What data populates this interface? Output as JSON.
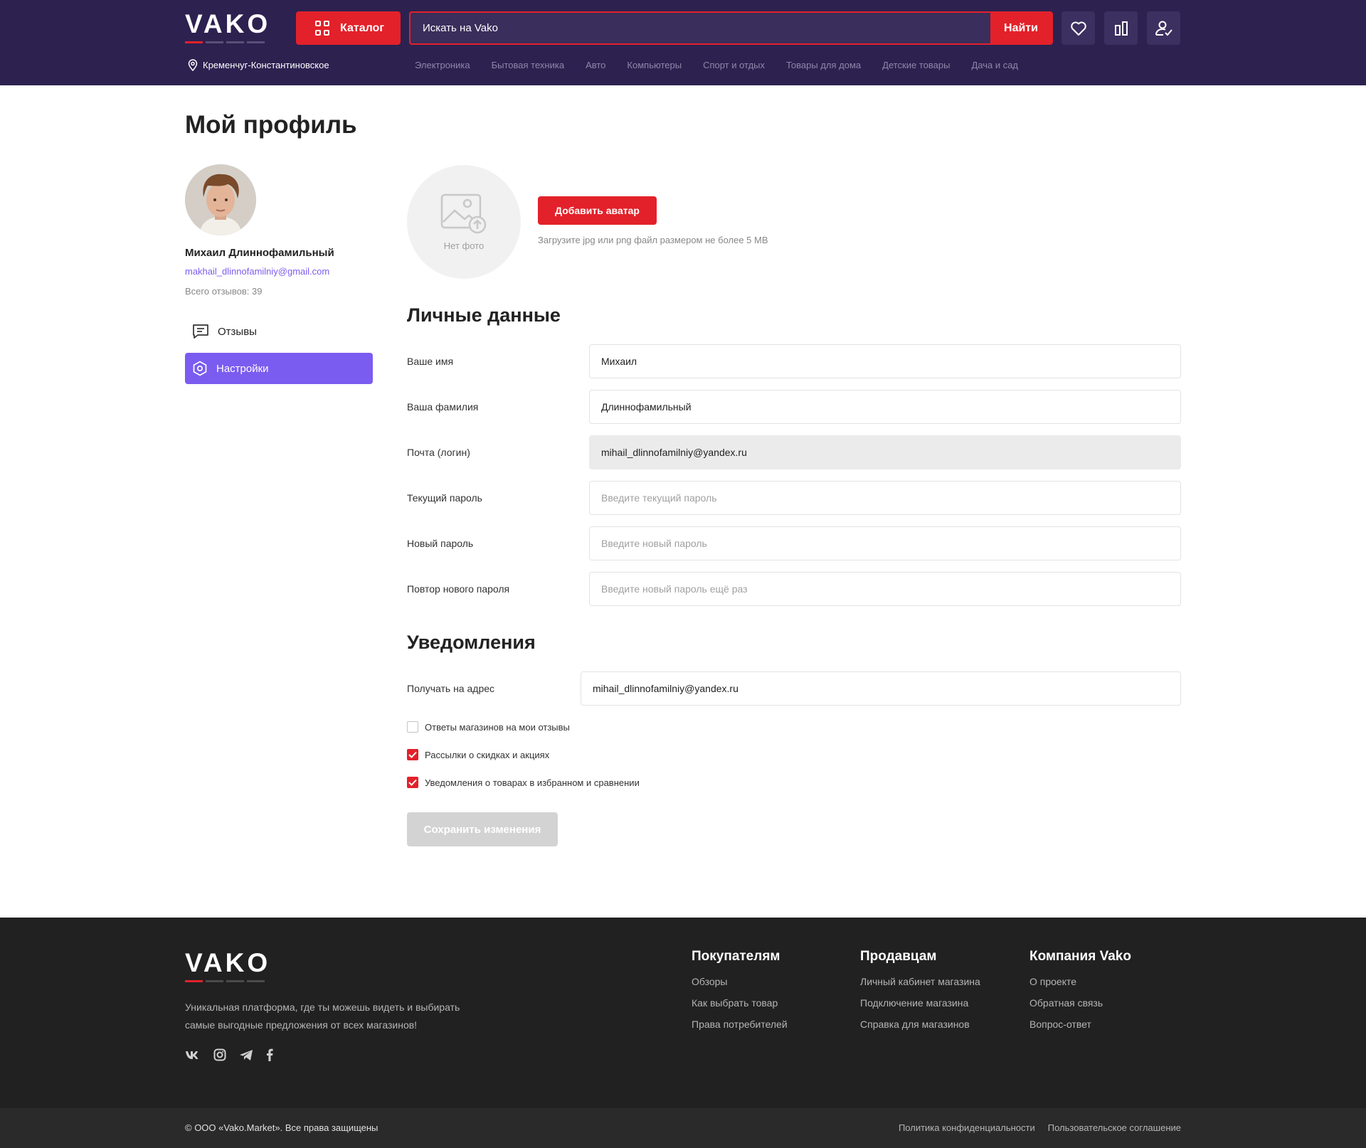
{
  "header": {
    "logo": "VAKO",
    "catalog_label": "Каталог",
    "search_placeholder": "Искать на Vako",
    "search_button": "Найти",
    "location": "Кременчуг-Константиновское",
    "categories": [
      "Электроника",
      "Бытовая техника",
      "Авто",
      "Компьютеры",
      "Спорт и отдых",
      "Товары для дома",
      "Детские товары",
      "Дача и сад"
    ]
  },
  "page": {
    "title": "Мой профиль"
  },
  "profile": {
    "name": "Михаил Длиннофамильный",
    "email": "makhail_dlinnofamilniy@gmail.com",
    "reviews_count": "Всего отзывов: 39"
  },
  "sidebar": {
    "items": [
      {
        "label": "Отзывы",
        "icon": "chat-icon",
        "active": false
      },
      {
        "label": "Настройки",
        "icon": "settings-icon",
        "active": true
      }
    ]
  },
  "avatar_upload": {
    "no_photo": "Нет фото",
    "button": "Добавить аватар",
    "hint": "Загрузите jpg или png файл размером не более 5 MB"
  },
  "personal": {
    "title": "Личные данные",
    "fields": [
      {
        "label": "Ваше имя",
        "value": "Михаил",
        "placeholder": ""
      },
      {
        "label": "Ваша фамилия",
        "value": "Длиннофамильный",
        "placeholder": ""
      },
      {
        "label": "Почта (логин)",
        "value": "mihail_dlinnofamilniy@yandex.ru",
        "placeholder": ""
      },
      {
        "label": "Текущий пароль",
        "value": "",
        "placeholder": "Введите текущий пароль"
      },
      {
        "label": "Новый пароль",
        "value": "",
        "placeholder": "Введите новый пароль"
      },
      {
        "label": "Повтор нового пароля",
        "value": "",
        "placeholder": "Введите новый пароль ещё раз"
      }
    ]
  },
  "notifications": {
    "title": "Уведомления",
    "address_label": "Получать на адрес",
    "address_value": "mihail_dlinnofamilniy@yandex.ru",
    "options": [
      {
        "label": "Ответы магазинов на мои отзывы",
        "checked": false
      },
      {
        "label": "Рассылки о скидках и акциях",
        "checked": true
      },
      {
        "label": "Уведомления о товарах в избранном и сравнении",
        "checked": true
      }
    ],
    "save_button": "Сохранить изменения"
  },
  "footer": {
    "logo": "VAKO",
    "description": "Уникальная платформа, где ты можешь видеть и выбирать самые выгодные предложения от всех магазинов!",
    "columns": [
      {
        "title": "Покупателям",
        "links": [
          "Обзоры",
          "Как выбрать товар",
          "Права потребителей"
        ]
      },
      {
        "title": "Продавцам",
        "links": [
          "Личный кабинет магазина",
          "Подключение магазина",
          "Справка для магазинов"
        ]
      },
      {
        "title": "Компания Vako",
        "links": [
          "О проекте",
          "Обратная связь",
          "Вопрос-ответ"
        ]
      }
    ],
    "copyright": "© ООО «Vako.Market». Все права защищены",
    "legal_links": [
      "Политика конфиденциальности",
      "Пользовательское соглашение"
    ]
  },
  "colors": {
    "header_bg": "#2d2150",
    "accent_red": "#e3212a",
    "accent_purple": "#7b5cf0",
    "footer_bg": "#212121"
  }
}
